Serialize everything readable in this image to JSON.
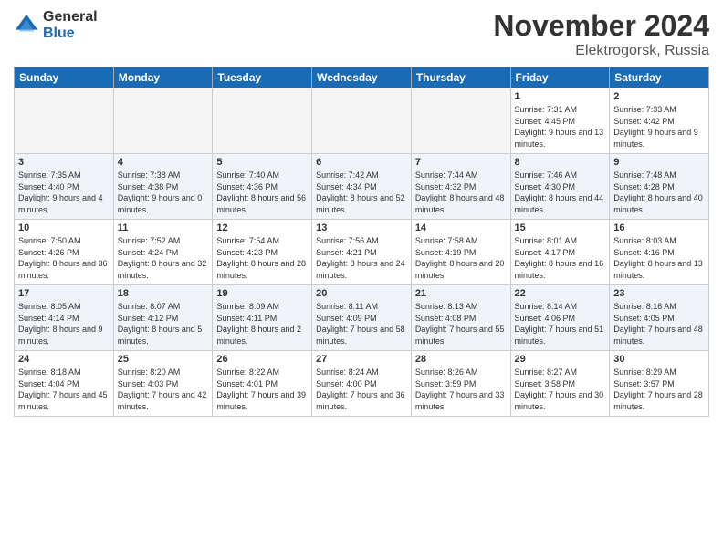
{
  "logo": {
    "general": "General",
    "blue": "Blue"
  },
  "header": {
    "month": "November 2024",
    "location": "Elektrogorsk, Russia"
  },
  "weekdays": [
    "Sunday",
    "Monday",
    "Tuesday",
    "Wednesday",
    "Thursday",
    "Friday",
    "Saturday"
  ],
  "rows": [
    [
      {
        "day": "",
        "info": ""
      },
      {
        "day": "",
        "info": ""
      },
      {
        "day": "",
        "info": ""
      },
      {
        "day": "",
        "info": ""
      },
      {
        "day": "",
        "info": ""
      },
      {
        "day": "1",
        "info": "Sunrise: 7:31 AM\nSunset: 4:45 PM\nDaylight: 9 hours\nand 13 minutes."
      },
      {
        "day": "2",
        "info": "Sunrise: 7:33 AM\nSunset: 4:42 PM\nDaylight: 9 hours\nand 9 minutes."
      }
    ],
    [
      {
        "day": "3",
        "info": "Sunrise: 7:35 AM\nSunset: 4:40 PM\nDaylight: 9 hours\nand 4 minutes."
      },
      {
        "day": "4",
        "info": "Sunrise: 7:38 AM\nSunset: 4:38 PM\nDaylight: 9 hours\nand 0 minutes."
      },
      {
        "day": "5",
        "info": "Sunrise: 7:40 AM\nSunset: 4:36 PM\nDaylight: 8 hours\nand 56 minutes."
      },
      {
        "day": "6",
        "info": "Sunrise: 7:42 AM\nSunset: 4:34 PM\nDaylight: 8 hours\nand 52 minutes."
      },
      {
        "day": "7",
        "info": "Sunrise: 7:44 AM\nSunset: 4:32 PM\nDaylight: 8 hours\nand 48 minutes."
      },
      {
        "day": "8",
        "info": "Sunrise: 7:46 AM\nSunset: 4:30 PM\nDaylight: 8 hours\nand 44 minutes."
      },
      {
        "day": "9",
        "info": "Sunrise: 7:48 AM\nSunset: 4:28 PM\nDaylight: 8 hours\nand 40 minutes."
      }
    ],
    [
      {
        "day": "10",
        "info": "Sunrise: 7:50 AM\nSunset: 4:26 PM\nDaylight: 8 hours\nand 36 minutes."
      },
      {
        "day": "11",
        "info": "Sunrise: 7:52 AM\nSunset: 4:24 PM\nDaylight: 8 hours\nand 32 minutes."
      },
      {
        "day": "12",
        "info": "Sunrise: 7:54 AM\nSunset: 4:23 PM\nDaylight: 8 hours\nand 28 minutes."
      },
      {
        "day": "13",
        "info": "Sunrise: 7:56 AM\nSunset: 4:21 PM\nDaylight: 8 hours\nand 24 minutes."
      },
      {
        "day": "14",
        "info": "Sunrise: 7:58 AM\nSunset: 4:19 PM\nDaylight: 8 hours\nand 20 minutes."
      },
      {
        "day": "15",
        "info": "Sunrise: 8:01 AM\nSunset: 4:17 PM\nDaylight: 8 hours\nand 16 minutes."
      },
      {
        "day": "16",
        "info": "Sunrise: 8:03 AM\nSunset: 4:16 PM\nDaylight: 8 hours\nand 13 minutes."
      }
    ],
    [
      {
        "day": "17",
        "info": "Sunrise: 8:05 AM\nSunset: 4:14 PM\nDaylight: 8 hours\nand 9 minutes."
      },
      {
        "day": "18",
        "info": "Sunrise: 8:07 AM\nSunset: 4:12 PM\nDaylight: 8 hours\nand 5 minutes."
      },
      {
        "day": "19",
        "info": "Sunrise: 8:09 AM\nSunset: 4:11 PM\nDaylight: 8 hours\nand 2 minutes."
      },
      {
        "day": "20",
        "info": "Sunrise: 8:11 AM\nSunset: 4:09 PM\nDaylight: 7 hours\nand 58 minutes."
      },
      {
        "day": "21",
        "info": "Sunrise: 8:13 AM\nSunset: 4:08 PM\nDaylight: 7 hours\nand 55 minutes."
      },
      {
        "day": "22",
        "info": "Sunrise: 8:14 AM\nSunset: 4:06 PM\nDaylight: 7 hours\nand 51 minutes."
      },
      {
        "day": "23",
        "info": "Sunrise: 8:16 AM\nSunset: 4:05 PM\nDaylight: 7 hours\nand 48 minutes."
      }
    ],
    [
      {
        "day": "24",
        "info": "Sunrise: 8:18 AM\nSunset: 4:04 PM\nDaylight: 7 hours\nand 45 minutes."
      },
      {
        "day": "25",
        "info": "Sunrise: 8:20 AM\nSunset: 4:03 PM\nDaylight: 7 hours\nand 42 minutes."
      },
      {
        "day": "26",
        "info": "Sunrise: 8:22 AM\nSunset: 4:01 PM\nDaylight: 7 hours\nand 39 minutes."
      },
      {
        "day": "27",
        "info": "Sunrise: 8:24 AM\nSunset: 4:00 PM\nDaylight: 7 hours\nand 36 minutes."
      },
      {
        "day": "28",
        "info": "Sunrise: 8:26 AM\nSunset: 3:59 PM\nDaylight: 7 hours\nand 33 minutes."
      },
      {
        "day": "29",
        "info": "Sunrise: 8:27 AM\nSunset: 3:58 PM\nDaylight: 7 hours\nand 30 minutes."
      },
      {
        "day": "30",
        "info": "Sunrise: 8:29 AM\nSunset: 3:57 PM\nDaylight: 7 hours\nand 28 minutes."
      }
    ]
  ]
}
